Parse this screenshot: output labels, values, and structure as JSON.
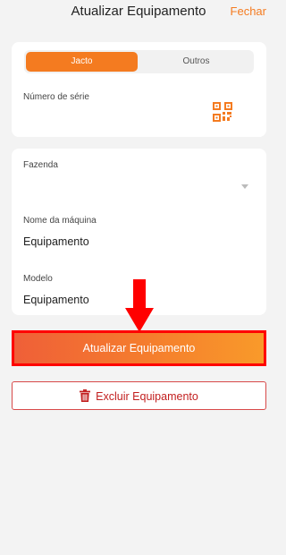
{
  "header": {
    "title": "Atualizar Equipamento",
    "close_label": "Fechar"
  },
  "segmented": {
    "options": [
      "Jacto",
      "Outros"
    ],
    "selected": "Jacto"
  },
  "serial": {
    "label": "Número de série",
    "value": "",
    "icon": "qr-code-icon"
  },
  "form": {
    "farm_label": "Fazenda",
    "farm_value": "",
    "machine_name_label": "Nome da máquina",
    "machine_name_value": "Equipamento",
    "model_label": "Modelo",
    "model_value": "Equipamento"
  },
  "actions": {
    "update_label": "Atualizar Equipamento",
    "delete_label": "Excluir Equipamento",
    "delete_icon": "trash-icon"
  },
  "colors": {
    "accent": "#f47b20",
    "danger": "#c21f1f",
    "annotation": "#ff0000"
  }
}
